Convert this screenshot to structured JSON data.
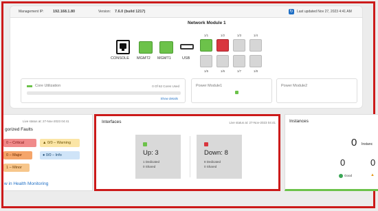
{
  "header": {
    "mgmt_ip_label": "Management IP:",
    "mgmt_ip": "192.168.1.80",
    "version_label": "Version:",
    "version": "7.6.0 (build 1217)",
    "last_updated": "Last updated Nov 27, 2023 4:41 AM"
  },
  "chassis": {
    "console": "CONSOLE",
    "mgmt2": "MGMT2",
    "mgmt1": "MGMT1",
    "usb": "USB",
    "network_module_title": "Network Module 1",
    "top_ports": [
      "1/1",
      "1/2",
      "1/3",
      "1/4"
    ],
    "bottom_ports": [
      "1/5",
      "1/6",
      "1/7",
      "1/8"
    ]
  },
  "summary": {
    "core_utilization": "Core Utilization",
    "cores_used": "0 Of 62 Cores Used",
    "show_details": "Show details",
    "power_module1": "Power Module1",
    "power_module2": "Power Module2"
  },
  "faults": {
    "live_status": "Live status at: 27-Nov-2023 04:41",
    "title": "gorized Faults",
    "critical": "0 – Critical",
    "warning": "0/0 – Warning",
    "major": "0 – Major",
    "info": "0/0 – Info",
    "minor": "1 – Minor",
    "link": "w in Health Monitoring"
  },
  "interfaces": {
    "title": "Interfaces",
    "live_status": "Live status at: 27-Nov-2023 04:41",
    "up": {
      "label": "Up: 3",
      "dedicated": "1 Dedicated",
      "shared": "0 Shared"
    },
    "down": {
      "label": "Down: 8",
      "dedicated": "8 Dedicated",
      "shared": "0 Shared"
    }
  },
  "instances": {
    "title": "Instances",
    "total_count": "0",
    "total_label": "Instanc",
    "good_count": "0",
    "good_label": "Good",
    "second_count": "0"
  },
  "colors": {
    "highlight_red": "#cc1a1a",
    "port_green": "#6cc24a",
    "port_red": "#d9363e",
    "port_gray": "#d6d6d6",
    "critical_bg": "#f08a8a",
    "major_bg": "#f5a56a",
    "minor_bg": "#f7c68b",
    "warning_bg": "#fbe5a5",
    "info_bg": "#cfe4f8"
  }
}
